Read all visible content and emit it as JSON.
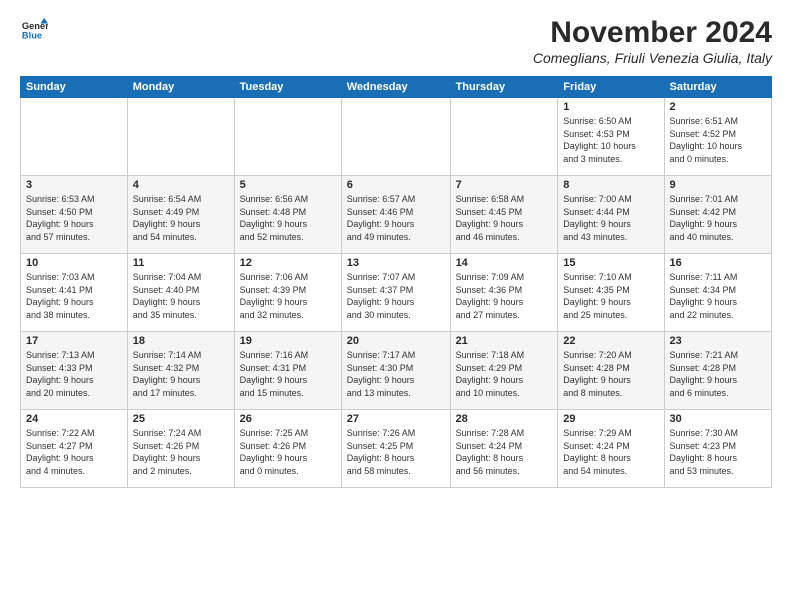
{
  "logo": {
    "line1": "General",
    "line2": "Blue"
  },
  "title": "November 2024",
  "subtitle": "Comeglians, Friuli Venezia Giulia, Italy",
  "headers": [
    "Sunday",
    "Monday",
    "Tuesday",
    "Wednesday",
    "Thursday",
    "Friday",
    "Saturday"
  ],
  "weeks": [
    [
      {
        "day": "",
        "info": ""
      },
      {
        "day": "",
        "info": ""
      },
      {
        "day": "",
        "info": ""
      },
      {
        "day": "",
        "info": ""
      },
      {
        "day": "",
        "info": ""
      },
      {
        "day": "1",
        "info": "Sunrise: 6:50 AM\nSunset: 4:53 PM\nDaylight: 10 hours\nand 3 minutes."
      },
      {
        "day": "2",
        "info": "Sunrise: 6:51 AM\nSunset: 4:52 PM\nDaylight: 10 hours\nand 0 minutes."
      }
    ],
    [
      {
        "day": "3",
        "info": "Sunrise: 6:53 AM\nSunset: 4:50 PM\nDaylight: 9 hours\nand 57 minutes."
      },
      {
        "day": "4",
        "info": "Sunrise: 6:54 AM\nSunset: 4:49 PM\nDaylight: 9 hours\nand 54 minutes."
      },
      {
        "day": "5",
        "info": "Sunrise: 6:56 AM\nSunset: 4:48 PM\nDaylight: 9 hours\nand 52 minutes."
      },
      {
        "day": "6",
        "info": "Sunrise: 6:57 AM\nSunset: 4:46 PM\nDaylight: 9 hours\nand 49 minutes."
      },
      {
        "day": "7",
        "info": "Sunrise: 6:58 AM\nSunset: 4:45 PM\nDaylight: 9 hours\nand 46 minutes."
      },
      {
        "day": "8",
        "info": "Sunrise: 7:00 AM\nSunset: 4:44 PM\nDaylight: 9 hours\nand 43 minutes."
      },
      {
        "day": "9",
        "info": "Sunrise: 7:01 AM\nSunset: 4:42 PM\nDaylight: 9 hours\nand 40 minutes."
      }
    ],
    [
      {
        "day": "10",
        "info": "Sunrise: 7:03 AM\nSunset: 4:41 PM\nDaylight: 9 hours\nand 38 minutes."
      },
      {
        "day": "11",
        "info": "Sunrise: 7:04 AM\nSunset: 4:40 PM\nDaylight: 9 hours\nand 35 minutes."
      },
      {
        "day": "12",
        "info": "Sunrise: 7:06 AM\nSunset: 4:39 PM\nDaylight: 9 hours\nand 32 minutes."
      },
      {
        "day": "13",
        "info": "Sunrise: 7:07 AM\nSunset: 4:37 PM\nDaylight: 9 hours\nand 30 minutes."
      },
      {
        "day": "14",
        "info": "Sunrise: 7:09 AM\nSunset: 4:36 PM\nDaylight: 9 hours\nand 27 minutes."
      },
      {
        "day": "15",
        "info": "Sunrise: 7:10 AM\nSunset: 4:35 PM\nDaylight: 9 hours\nand 25 minutes."
      },
      {
        "day": "16",
        "info": "Sunrise: 7:11 AM\nSunset: 4:34 PM\nDaylight: 9 hours\nand 22 minutes."
      }
    ],
    [
      {
        "day": "17",
        "info": "Sunrise: 7:13 AM\nSunset: 4:33 PM\nDaylight: 9 hours\nand 20 minutes."
      },
      {
        "day": "18",
        "info": "Sunrise: 7:14 AM\nSunset: 4:32 PM\nDaylight: 9 hours\nand 17 minutes."
      },
      {
        "day": "19",
        "info": "Sunrise: 7:16 AM\nSunset: 4:31 PM\nDaylight: 9 hours\nand 15 minutes."
      },
      {
        "day": "20",
        "info": "Sunrise: 7:17 AM\nSunset: 4:30 PM\nDaylight: 9 hours\nand 13 minutes."
      },
      {
        "day": "21",
        "info": "Sunrise: 7:18 AM\nSunset: 4:29 PM\nDaylight: 9 hours\nand 10 minutes."
      },
      {
        "day": "22",
        "info": "Sunrise: 7:20 AM\nSunset: 4:28 PM\nDaylight: 9 hours\nand 8 minutes."
      },
      {
        "day": "23",
        "info": "Sunrise: 7:21 AM\nSunset: 4:28 PM\nDaylight: 9 hours\nand 6 minutes."
      }
    ],
    [
      {
        "day": "24",
        "info": "Sunrise: 7:22 AM\nSunset: 4:27 PM\nDaylight: 9 hours\nand 4 minutes."
      },
      {
        "day": "25",
        "info": "Sunrise: 7:24 AM\nSunset: 4:26 PM\nDaylight: 9 hours\nand 2 minutes."
      },
      {
        "day": "26",
        "info": "Sunrise: 7:25 AM\nSunset: 4:26 PM\nDaylight: 9 hours\nand 0 minutes."
      },
      {
        "day": "27",
        "info": "Sunrise: 7:26 AM\nSunset: 4:25 PM\nDaylight: 8 hours\nand 58 minutes."
      },
      {
        "day": "28",
        "info": "Sunrise: 7:28 AM\nSunset: 4:24 PM\nDaylight: 8 hours\nand 56 minutes."
      },
      {
        "day": "29",
        "info": "Sunrise: 7:29 AM\nSunset: 4:24 PM\nDaylight: 8 hours\nand 54 minutes."
      },
      {
        "day": "30",
        "info": "Sunrise: 7:30 AM\nSunset: 4:23 PM\nDaylight: 8 hours\nand 53 minutes."
      }
    ]
  ]
}
